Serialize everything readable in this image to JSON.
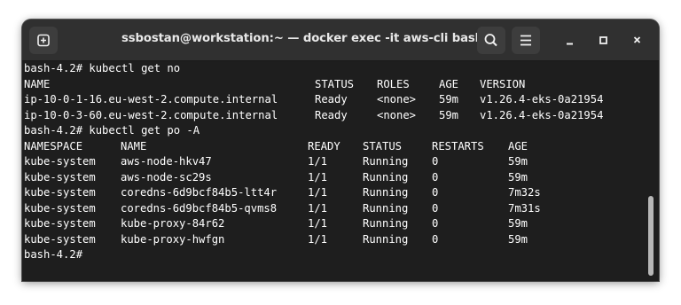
{
  "window": {
    "title": "ssbostan@workstation:~ — docker exec -it aws-cli bash"
  },
  "titlebar_icons": {
    "new_tab": "plus-square-icon",
    "search": "search-icon",
    "menu": "hamburger-menu-icon",
    "minimize": "minimize-icon",
    "maximize": "maximize-icon",
    "close": "close-icon"
  },
  "colors": {
    "terminal_bg": "#1e1e1e",
    "titlebar_bg": "#303030",
    "text": "#ffffff"
  },
  "terminal": {
    "cmd1": "bash-4.2# kubectl get no",
    "nodes": {
      "headers": [
        "NAME",
        "STATUS",
        "ROLES",
        "AGE",
        "VERSION"
      ],
      "rows": [
        [
          "ip-10-0-1-16.eu-west-2.compute.internal",
          "Ready",
          "<none>",
          "59m",
          "v1.26.4-eks-0a21954"
        ],
        [
          "ip-10-0-3-60.eu-west-2.compute.internal",
          "Ready",
          "<none>",
          "59m",
          "v1.26.4-eks-0a21954"
        ]
      ]
    },
    "cmd2": "bash-4.2# kubectl get po -A",
    "pods": {
      "headers": [
        "NAMESPACE",
        "NAME",
        "READY",
        "STATUS",
        "RESTARTS",
        "AGE"
      ],
      "rows": [
        [
          "kube-system",
          "aws-node-hkv47",
          "1/1",
          "Running",
          "0",
          "59m"
        ],
        [
          "kube-system",
          "aws-node-sc29s",
          "1/1",
          "Running",
          "0",
          "59m"
        ],
        [
          "kube-system",
          "coredns-6d9bcf84b5-ltt4r",
          "1/1",
          "Running",
          "0",
          "7m32s"
        ],
        [
          "kube-system",
          "coredns-6d9bcf84b5-qvms8",
          "1/1",
          "Running",
          "0",
          "7m31s"
        ],
        [
          "kube-system",
          "kube-proxy-84r62",
          "1/1",
          "Running",
          "0",
          "59m"
        ],
        [
          "kube-system",
          "kube-proxy-hwfgn",
          "1/1",
          "Running",
          "0",
          "59m"
        ]
      ]
    },
    "prompt": "bash-4.2# "
  }
}
